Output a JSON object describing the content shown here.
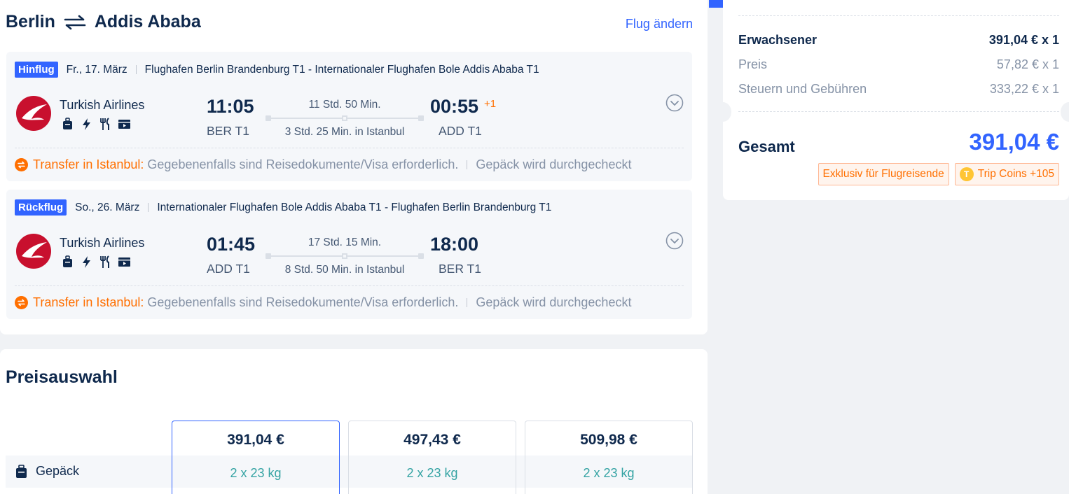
{
  "header": {
    "origin": "Berlin",
    "destination": "Addis Ababa",
    "change_label": "Flug ändern"
  },
  "outbound": {
    "tag": "Hinflug",
    "date": "Fr., 17. März",
    "route": "Flughafen Berlin Brandenburg T1 - Internationaler Flughafen Bole Addis Ababa T1",
    "airline": "Turkish Airlines",
    "dep_time": "11:05",
    "dep_airport": "BER T1",
    "duration": "11 Std. 50 Min.",
    "stopover": "3 Std. 25 Min. in Istanbul",
    "arr_time": "00:55",
    "day_offset": "+1",
    "arr_airport": "ADD T1",
    "transfer_label": "Transfer in Istanbul:",
    "transfer_note": "Gegebenenfalls sind Reisedokumente/Visa erforderlich.",
    "baggage_note": "Gepäck wird durchgecheckt"
  },
  "inbound": {
    "tag": "Rückflug",
    "date": "So., 26. März",
    "route": "Internationaler Flughafen Bole Addis Ababa T1 - Flughafen Berlin Brandenburg T1",
    "airline": "Turkish Airlines",
    "dep_time": "01:45",
    "dep_airport": "ADD T1",
    "duration": "17 Std. 15 Min.",
    "stopover": "8 Std. 50 Min. in Istanbul",
    "arr_time": "18:00",
    "arr_airport": "BER T1",
    "transfer_label": "Transfer in Istanbul:",
    "transfer_note": "Gegebenenfalls sind Reisedokumente/Visa erforderlich.",
    "baggage_note": "Gepäck wird durchgecheckt"
  },
  "fares": {
    "title": "Preisauswahl",
    "baggage_label": "Gepäck",
    "options": [
      {
        "price": "391,04 €",
        "baggage": "2 x 23 kg"
      },
      {
        "price": "497,43 €",
        "baggage": "2 x 23 kg"
      },
      {
        "price": "509,98 €",
        "baggage": "2 x 23 kg"
      }
    ]
  },
  "summary": {
    "adult_label": "Erwachsener",
    "adult_value": "391,04 € x 1",
    "price_label": "Preis",
    "price_value": "57,82 € x 1",
    "tax_label": "Steuern und Gebühren",
    "tax_value": "333,22 € x 1",
    "total_label": "Gesamt",
    "total_value": "391,04 €",
    "badge_exclusive": "Exklusiv für Flugreisende",
    "badge_coins": "Trip Coins +105",
    "coin_letter": "T"
  },
  "colors": {
    "accent": "#3264ff",
    "orange": "#ff6f00",
    "teal": "#34a3a3",
    "airline_red": "#c8102e"
  }
}
